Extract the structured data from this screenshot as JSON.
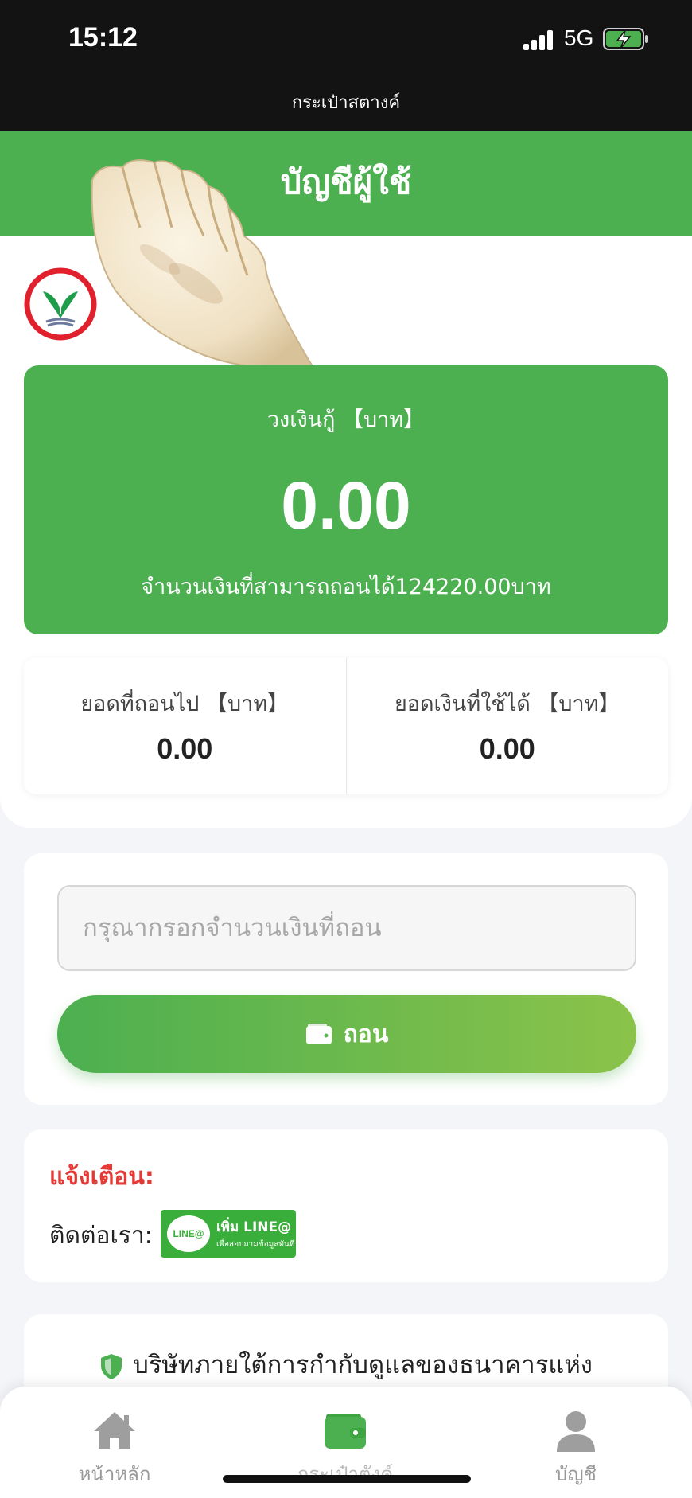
{
  "status_bar": {
    "time": "15:12",
    "network": "5G",
    "battery": "charging"
  },
  "nav": {
    "title": "กระเป๋าสตางค์"
  },
  "header": {
    "title": "บัญชีผู้ใช้"
  },
  "balance": {
    "label": "วงเงินกู้ 【บาท】",
    "amount": "0.00",
    "note": "จำนวนเงินที่สามารถถอนได้124220.00บาท"
  },
  "stats": [
    {
      "label": "ยอดที่ถอนไป 【บาท】",
      "value": "0.00"
    },
    {
      "label": "ยอดเงินที่ใช้ได้ 【บาท】",
      "value": "0.00"
    }
  ],
  "withdraw": {
    "placeholder": "กรุณากรอกจำนวนเงินที่ถอน",
    "button_label": "ถอน"
  },
  "alert": {
    "title": "แจ้งเตือน:",
    "contact_label": "ติดต่อเรา:",
    "line_badge": {
      "bubble": "LINE@",
      "main": "เพิ่ม LINE@",
      "sub": "เพื่อสอบถามข้อมูลทันที"
    }
  },
  "notice": {
    "text": "บริษัทภายใต้การกำกับดูแลของธนาคารแห่ง"
  },
  "tabs": [
    {
      "label": "หน้าหลัก",
      "icon": "home-icon"
    },
    {
      "label": "กระเป๋าตังค์",
      "icon": "wallet-icon"
    },
    {
      "label": "บัญชี",
      "icon": "user-icon"
    }
  ],
  "colors": {
    "brand_green": "#4caf50",
    "light_green": "#8bc34a",
    "alert_red": "#e53935",
    "bank_red": "#e0202c"
  }
}
